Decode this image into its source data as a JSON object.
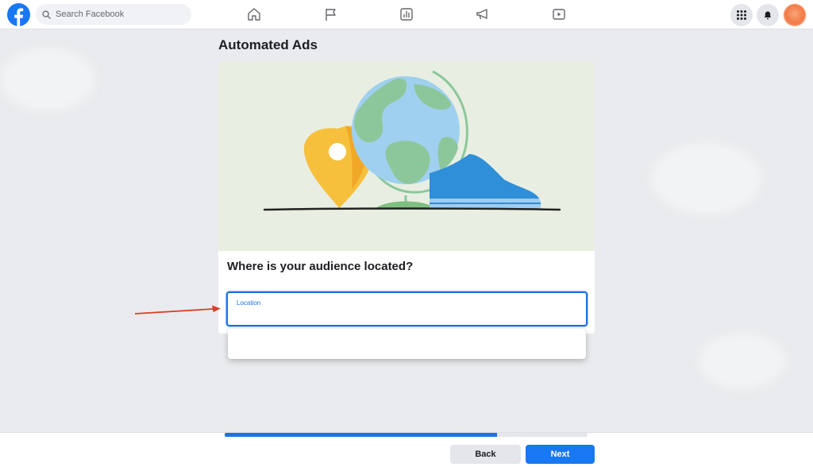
{
  "nav": {
    "search_placeholder": "Search Facebook",
    "icons": [
      "home-icon",
      "flag-icon",
      "insights-icon",
      "megaphone-icon",
      "video-icon"
    ],
    "right_icons": [
      "menu-grid-icon",
      "notifications-bell-icon",
      "avatar"
    ]
  },
  "page": {
    "title": "Automated Ads"
  },
  "form": {
    "question": "Where is your audience located?",
    "location_label": "Location",
    "location_value": ""
  },
  "progress": {
    "fraction": 0.75
  },
  "footer": {
    "back_label": "Back",
    "next_label": "Next"
  },
  "colors": {
    "brand_blue": "#1877f2",
    "focus_blue": "#1b74e4",
    "arrow_red": "#d9402a",
    "hero_bg": "#e8efe2"
  }
}
